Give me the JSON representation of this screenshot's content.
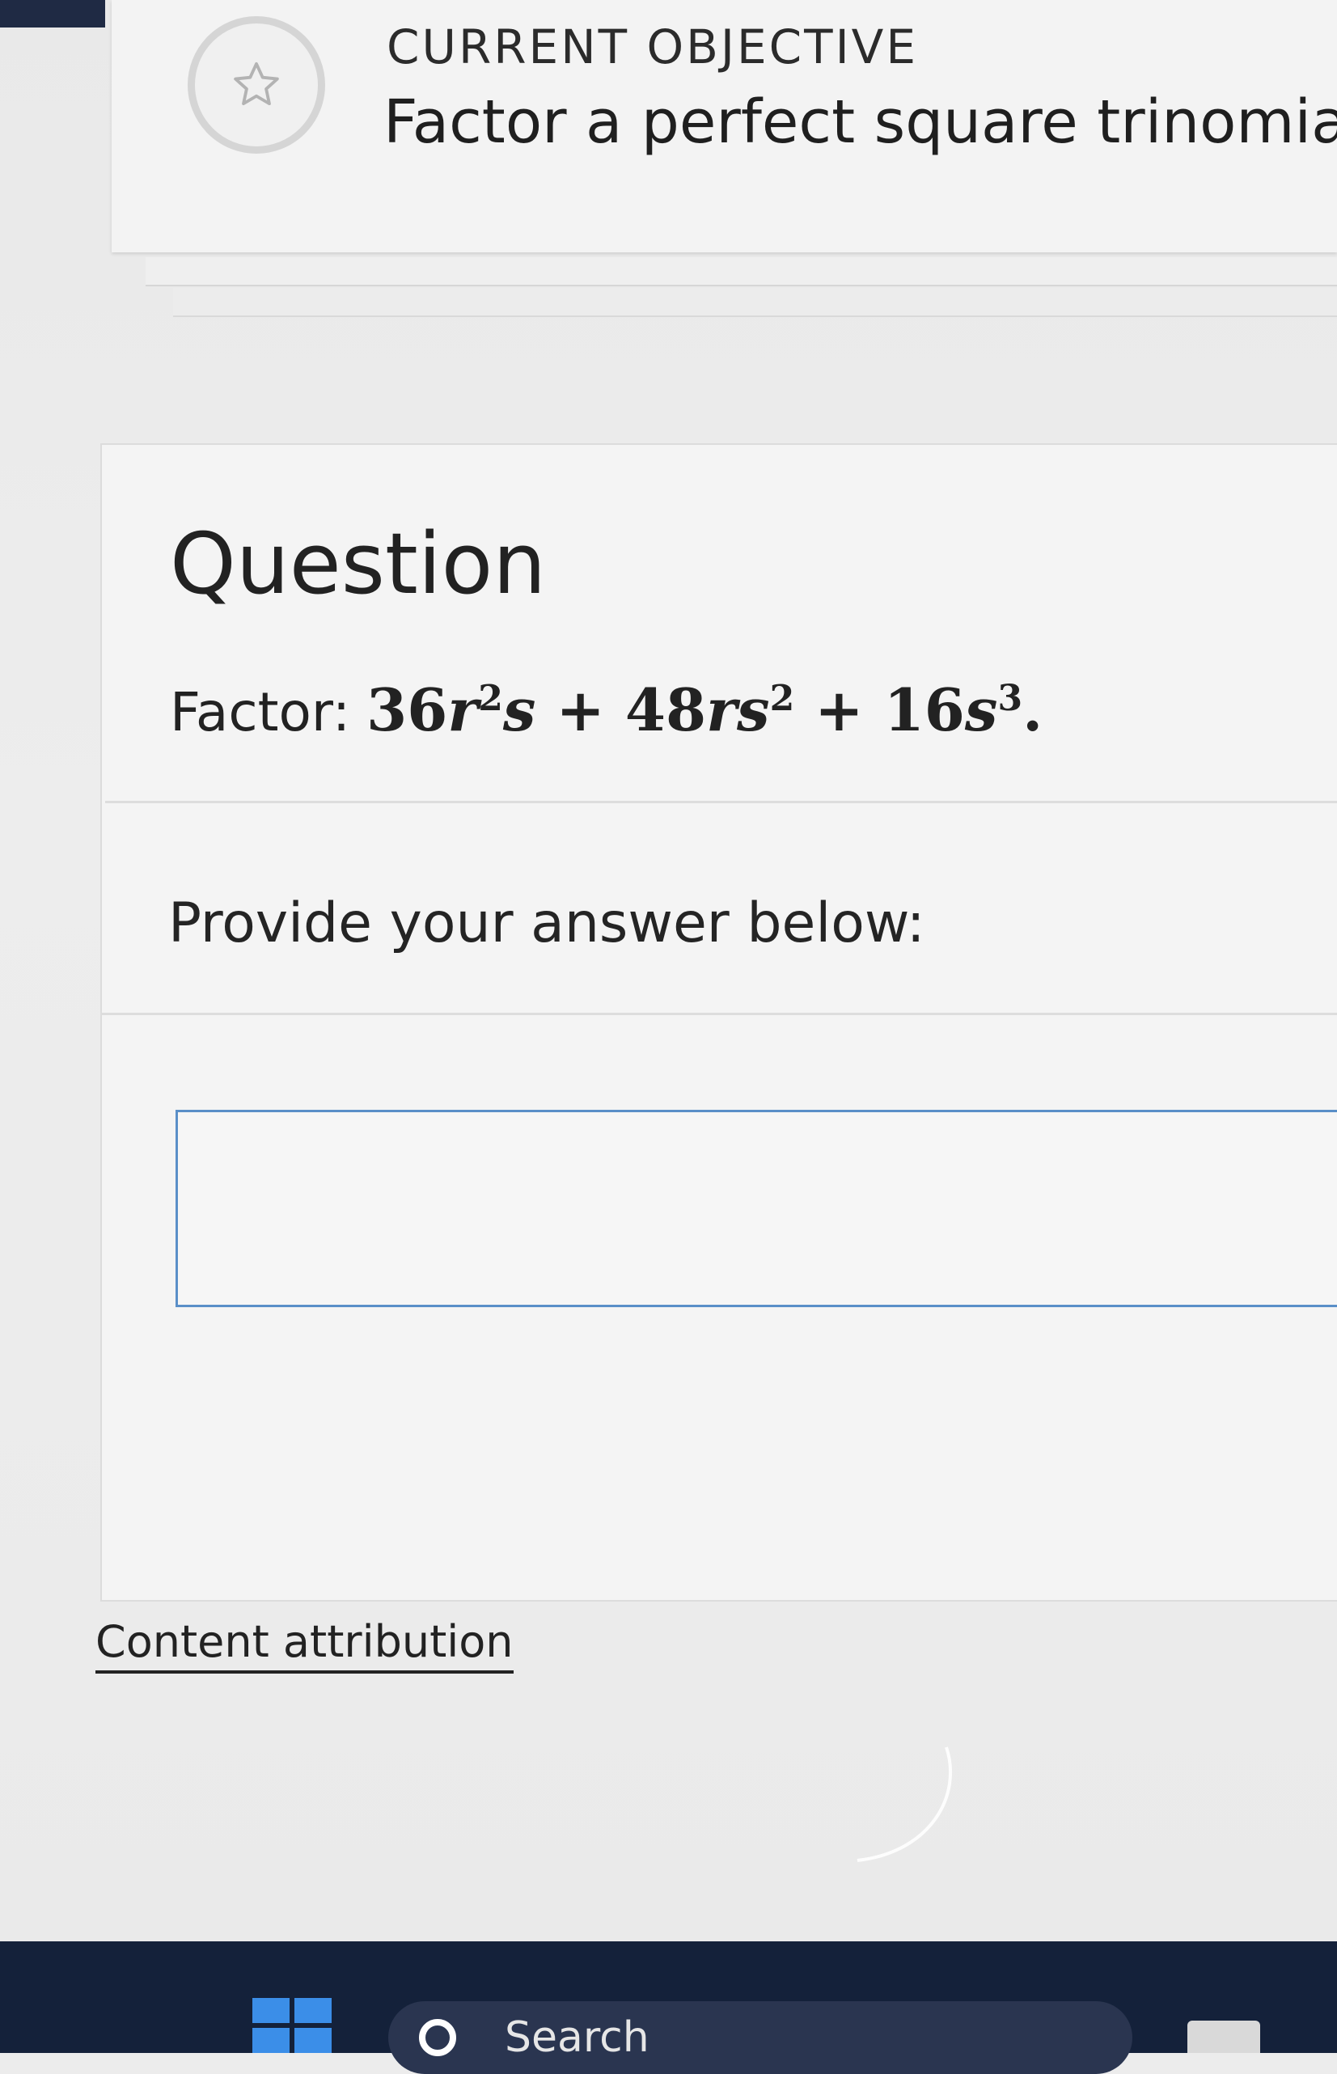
{
  "objective": {
    "label": "CURRENT OBJECTIVE",
    "title": "Factor a perfect square trinomial",
    "icon": "star-icon"
  },
  "question": {
    "heading": "Question",
    "prompt_label": "Factor:",
    "expression": {
      "t1_coef": "36",
      "t1_var1": "r",
      "t1_exp1": "2",
      "t1_var2": "s",
      "op1": "+",
      "t2_coef": "48",
      "t2_var1": "r",
      "t2_var2": "s",
      "t2_exp2": "2",
      "op2": "+",
      "t3_coef": "16",
      "t3_var": "s",
      "t3_exp": "3",
      "period": "."
    },
    "answer_prompt": "Provide your answer below:",
    "answer_value": ""
  },
  "footer": {
    "attribution": "Content attribution"
  },
  "taskbar": {
    "search_label": "Search",
    "start_icon": "windows-logo-icon",
    "search_icon": "search-icon"
  },
  "colors": {
    "taskbar": "#14213a",
    "input_border": "#5a8fc8",
    "windows_blue": "#3b8ee8"
  }
}
